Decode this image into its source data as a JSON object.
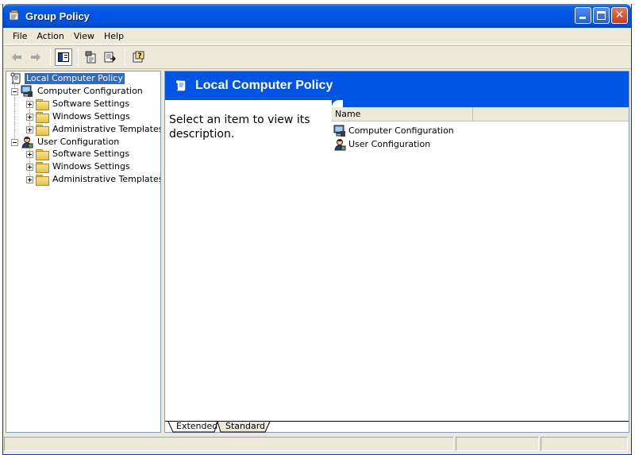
{
  "window": {
    "title": "Group Policy",
    "accent": "#0055e5"
  },
  "menu": [
    {
      "label": "File"
    },
    {
      "label": "Action"
    },
    {
      "label": "View"
    },
    {
      "label": "Help"
    }
  ],
  "toolbar": {
    "back_icon": "back-arrow-icon",
    "forward_icon": "forward-arrow-icon",
    "show_hide_tree_icon": "show-hide-tree-icon",
    "properties_icon": "properties-icon",
    "export_list_icon": "export-list-icon",
    "help_icon": "help-icon"
  },
  "tree": {
    "root": "Local Computer Policy",
    "computer_config": "Computer Configuration",
    "computer_children": [
      "Software Settings",
      "Windows Settings",
      "Administrative Templates"
    ],
    "user_config": "User Configuration",
    "user_children": [
      "Software Settings",
      "Windows Settings",
      "Administrative Templates"
    ]
  },
  "details": {
    "title": "Local Computer Policy",
    "description": "Select an item to view its description.",
    "column_name": "Name",
    "items": [
      "Computer Configuration",
      "User Configuration"
    ]
  },
  "tabs": {
    "extended": "Extended",
    "standard": "Standard"
  }
}
